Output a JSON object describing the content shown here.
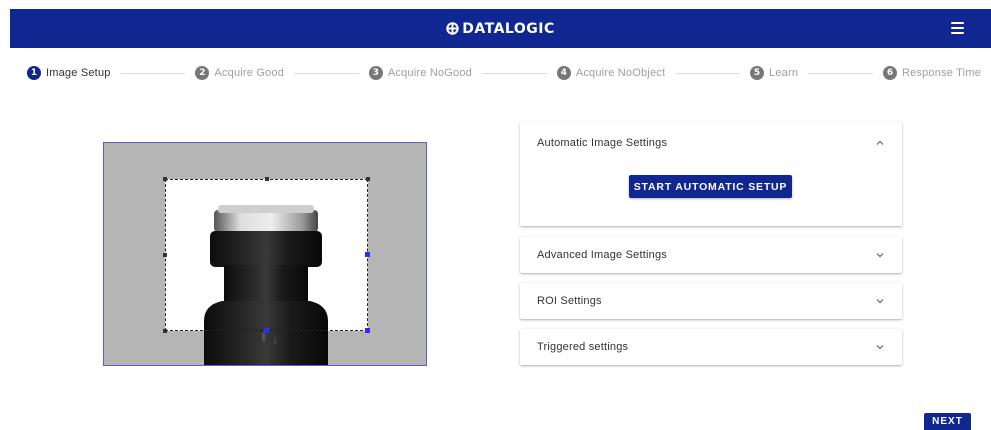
{
  "header": {
    "brand": "DATALOGIC",
    "brand_icon": "datalogic-logo-icon",
    "menu_icon": "hamburger-menu-icon",
    "bg_color": "#102691"
  },
  "stepper": {
    "steps": [
      {
        "num": "1",
        "label": "Image Setup",
        "active": true
      },
      {
        "num": "2",
        "label": "Acquire Good",
        "active": false
      },
      {
        "num": "3",
        "label": "Acquire NoGood",
        "active": false
      },
      {
        "num": "4",
        "label": "Acquire NoObject",
        "active": false
      },
      {
        "num": "5",
        "label": "Learn",
        "active": false
      },
      {
        "num": "6",
        "label": "Response Time",
        "active": false
      }
    ]
  },
  "accordion": {
    "automatic": {
      "title": "Automatic Image Settings",
      "expanded": true,
      "button": "START AUTOMATIC SETUP"
    },
    "advanced": {
      "title": "Advanced Image Settings",
      "expanded": false
    },
    "roi": {
      "title": "ROI Settings",
      "expanded": false
    },
    "triggered": {
      "title": "Triggered settings",
      "expanded": false
    }
  },
  "footer": {
    "next": "NEXT"
  },
  "colors": {
    "accent": "#102691",
    "inactive_step": "#777777",
    "viewer_bg": "#b5b5b5"
  }
}
